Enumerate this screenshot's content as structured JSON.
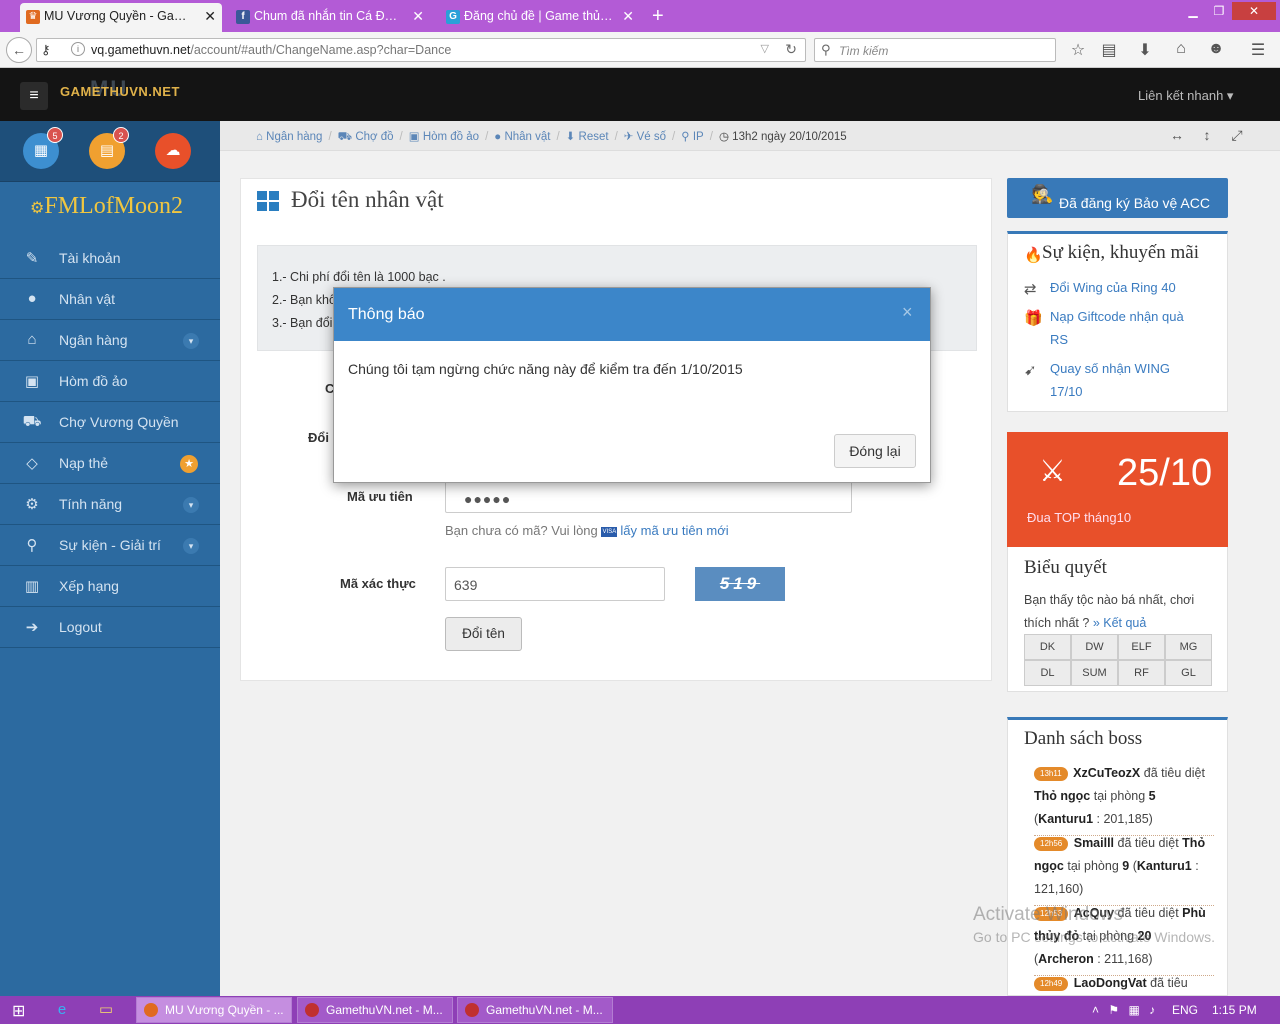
{
  "browser": {
    "tabs": [
      {
        "title": "MU Vương Quyền - Game...",
        "icon": "M",
        "icon_color": "#e06a20",
        "active": true
      },
      {
        "title": "Chum đã nhắn tin Cá Độ ...",
        "icon": "f",
        "icon_color": "#3b5998",
        "active": false
      },
      {
        "title": "Đăng chủ đề | Game thủ V...",
        "icon": "G",
        "icon_color": "#2aa0d8",
        "active": false
      }
    ],
    "new_tab": "+",
    "url_domain": "vq.gamethuvn.net",
    "url_path": "/account/#auth/ChangeName.asp?char=Dance",
    "search_placeholder": "Tìm kiếm"
  },
  "site": {
    "logo": "GAMETHUVN.NET",
    "logo_mark": "MU",
    "quick_link": "Liên kết nhanh"
  },
  "sidebar": {
    "badges": [
      "5",
      "2"
    ],
    "character_name": "FMLofMoon2",
    "items": [
      {
        "label": "Tài khoản",
        "icon": "✎",
        "chevron": false,
        "star": false
      },
      {
        "label": "Nhân vật",
        "icon": "●",
        "chevron": false,
        "star": false
      },
      {
        "label": "Ngân hàng",
        "icon": "⌂",
        "chevron": true,
        "star": false
      },
      {
        "label": "Hòm đồ ảo",
        "icon": "▣",
        "chevron": false,
        "star": false
      },
      {
        "label": "Chợ Vương Quyền",
        "icon": "⛟",
        "chevron": false,
        "star": false
      },
      {
        "label": "Nạp thẻ",
        "icon": "◇",
        "chevron": false,
        "star": true
      },
      {
        "label": "Tính năng",
        "icon": "⚙",
        "chevron": true,
        "star": false
      },
      {
        "label": "Sự kiện - Giải trí",
        "icon": "⚲",
        "chevron": true,
        "star": false
      },
      {
        "label": "Xếp hạng",
        "icon": "▥",
        "chevron": false,
        "star": false
      },
      {
        "label": "Logout",
        "icon": "➔",
        "chevron": false,
        "star": false
      }
    ]
  },
  "breadcrumb": {
    "items": [
      "Ngân hàng",
      "Chợ đồ",
      "Hòm đồ ảo",
      "Nhân vật",
      "Reset",
      "Vé số",
      "IP"
    ],
    "time": "13h2 ngày 20/10/2015"
  },
  "main": {
    "title": "Đổi tên nhân vật",
    "notes": [
      "1.- Chi phí đổi tên là 1000 bạc .",
      "2.- Bạn khô",
      "3.- Bạn đổi"
    ],
    "label_c": "C",
    "label_doi": "Đổi",
    "priority_label": "Mã ưu tiên",
    "priority_value": "●●●●●",
    "hint_text": "Bạn chưa có mã? Vui lòng",
    "hint_visa": "VISA",
    "hint_link": "lấy mã ưu tiên mới",
    "captcha_label": "Mã xác thực",
    "captcha_value": "639",
    "captcha_image_text": "519",
    "submit": "Đổi tên"
  },
  "right": {
    "protect": "Đã đăng ký Bảo vệ ACC",
    "events_title": "Sự kiện, khuyến mãi",
    "events": [
      {
        "text": "Đổi Wing của Ring 40",
        "icon": "⇄"
      },
      {
        "text": "Nạp Giftcode nhận quà RS",
        "icon": "🎁"
      },
      {
        "text": "Quay số nhận WING 17/10",
        "icon": "➹"
      }
    ],
    "promo_date": "25/10",
    "promo_sub": "Đua TOP tháng10",
    "poll_title": "Biểu quyết",
    "poll_question": "Bạn thấy tộc nào bá nhất, chơi thích nhất ?",
    "poll_result": "» Kết quả",
    "tribes": [
      "DK",
      "DW",
      "ELF",
      "MG",
      "DL",
      "SUM",
      "RF",
      "GL"
    ],
    "boss_title": "Danh sách boss",
    "boss": [
      {
        "time": "13h11",
        "player": "XzCuTeozX",
        "kill": "đã tiêu diệt",
        "boss": "Thỏ ngọc",
        "room_label": "tại phòng",
        "room": "5",
        "map": "Kanturu1",
        "coords": ": 201,185)"
      },
      {
        "time": "12h56",
        "player": "Smailll",
        "kill": "đã tiêu diệt",
        "boss": "Thỏ ngọc",
        "room_label": "tại phòng",
        "room": "9",
        "map": "Kanturu1",
        "coords": ": 121,160)"
      },
      {
        "time": "12h53",
        "player": "AcQuy",
        "kill": "đã tiêu diệt",
        "boss": "Phù thủy đỏ",
        "room_label": "tại phòng",
        "room": "20",
        "map": "Archeron",
        "coords": ": 211,168)"
      },
      {
        "time": "12h49",
        "player": "LaoDongVat",
        "kill": "đã tiêu",
        "boss": "",
        "room_label": "",
        "room": "",
        "map": "",
        "coords": ""
      }
    ]
  },
  "modal": {
    "title": "Thông báo",
    "close": "×",
    "message": "Chúng tôi tạm ngừng chức năng này để kiểm tra đến 1/10/2015",
    "button": "Đóng lại"
  },
  "watermark": {
    "line1": "Activate Windows",
    "line2": "Go to PC settings to activate Windows."
  },
  "taskbar": {
    "tasks": [
      "MU Vương Quyền - ...",
      "GamethuVN.net - M...",
      "GamethuVN.net - M..."
    ],
    "lang": "ENG",
    "clock": "1:15 PM"
  }
}
